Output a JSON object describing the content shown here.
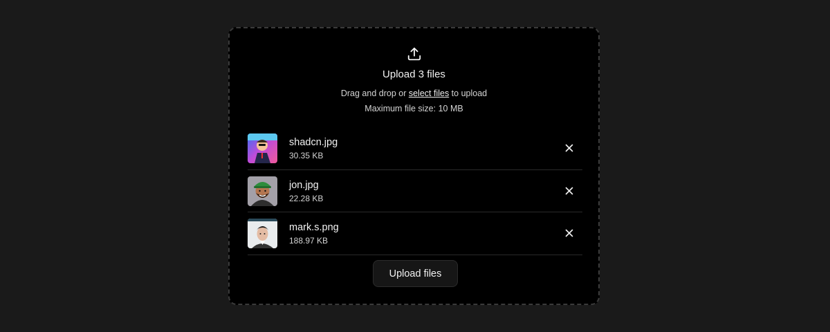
{
  "dropzone": {
    "icon": "upload-icon",
    "title": "Upload 3 files",
    "description_prefix": "Drag and drop or ",
    "select_link": "select files",
    "description_suffix": " to upload",
    "max_size_text": "Maximum file size: 10 MB"
  },
  "files": [
    {
      "name": "shadcn.jpg",
      "size": "30.35 KB",
      "remove_icon": "close-icon"
    },
    {
      "name": "jon.jpg",
      "size": "22.28 KB",
      "remove_icon": "close-icon"
    },
    {
      "name": "mark.s.png",
      "size": "188.97 KB",
      "remove_icon": "close-icon"
    }
  ],
  "actions": {
    "upload_label": "Upload files"
  },
  "colors": {
    "page_background": "#1a1a1a",
    "panel_background": "#000000",
    "dashed_border": "#3a3a3a",
    "text_primary": "#f2f2f2",
    "text_secondary": "#d4d4d4"
  }
}
